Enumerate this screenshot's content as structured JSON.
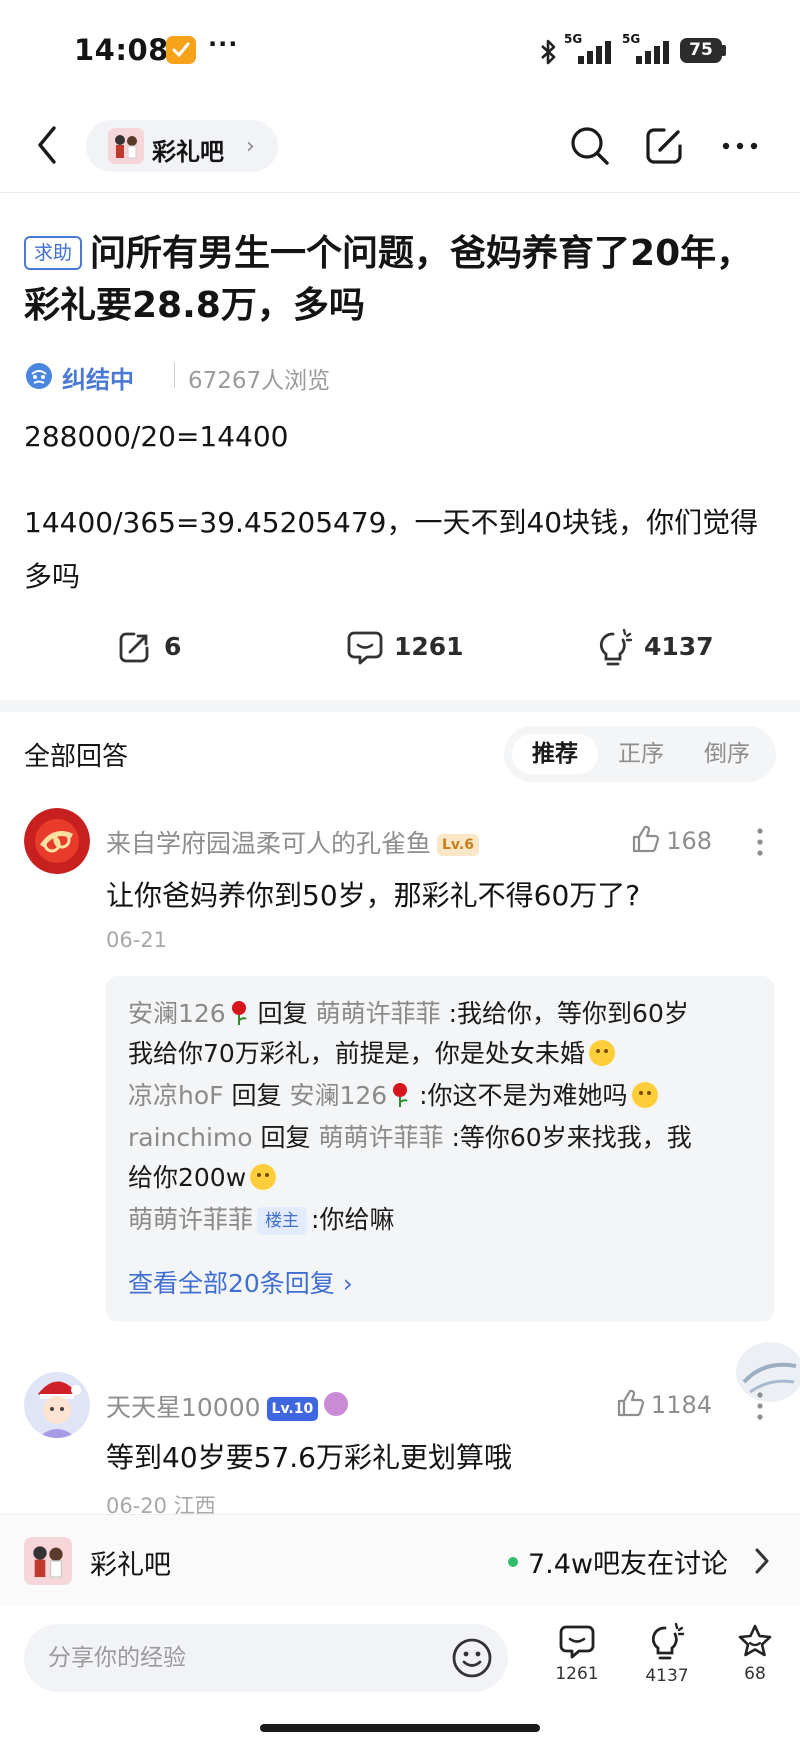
{
  "status_bar": {
    "time": "14:08",
    "dots": "···",
    "signal1": "5G",
    "signal2": "5G",
    "battery": "75"
  },
  "nav": {
    "forum_name": "彩礼吧",
    "chevron": "›"
  },
  "post": {
    "tag": "求助",
    "title": "问所有男生一个问题，爸妈养育了20年，彩礼要28.8万，多吗",
    "status": "纠结中",
    "views": "67267人浏览",
    "body_line1": "288000/20=14400",
    "body_line2": "14400/365=39.45205479，一天不到40块钱，你们觉得多吗",
    "actions": {
      "share_count": "6",
      "comment_count": "1261",
      "idea_count": "4137"
    }
  },
  "answers": {
    "title": "全部回答",
    "sort_options": [
      "推荐",
      "正序",
      "倒序"
    ],
    "active_sort": "推荐"
  },
  "comments": [
    {
      "author": "来自学府园温柔可人的孔雀鱼",
      "level": "Lv.6",
      "likes": "168",
      "text": "让你爸妈养你到50岁，那彩礼不得60万了?",
      "meta": "06-21",
      "replies": [
        {
          "user": "安澜126",
          "verb": "回复",
          "target": "萌萌许菲菲",
          "text": ":我给你，等你到60岁",
          "text2": "我给你70万彩礼，前提是，你是处女未婚"
        },
        {
          "user": "凉凉hoF",
          "verb": "回复",
          "target": "安澜126",
          "text": ":你这不是为难她吗"
        },
        {
          "user": "rainchimo",
          "verb": "回复",
          "target": "萌萌许菲菲",
          "text": ":等你60岁来找我，我",
          "text2": "给你200w"
        },
        {
          "user": "萌萌许菲菲",
          "host_tag": "楼主",
          "text": ":你给嘛"
        }
      ],
      "view_all": "查看全部20条回复 ›"
    },
    {
      "author": "天天星10000",
      "level": "Lv.10",
      "likes": "1184",
      "text": "等到40岁要57.6万彩礼更划算哦",
      "meta": "06-20 江西"
    }
  ],
  "forum_banner": {
    "name": "彩礼吧",
    "online": "7.4w吧友在讨论"
  },
  "bottom_bar": {
    "placeholder": "分享你的经验",
    "comment_count": "1261",
    "idea_count": "4137",
    "star_count": "68"
  },
  "colors": {
    "accent_blue": "#3f6fd2",
    "online_green": "#2fbf6a",
    "gray_text": "#8e8e8e"
  }
}
